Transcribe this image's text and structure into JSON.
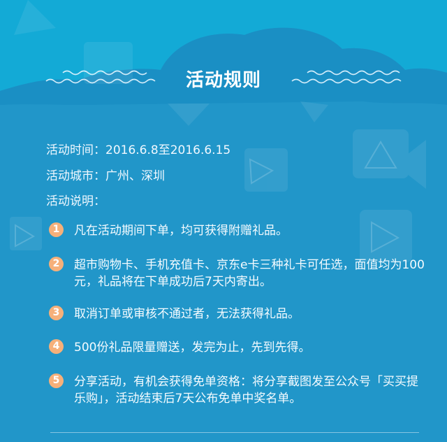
{
  "title": "活动规则",
  "info": {
    "time": "活动时间：2016.6.8至2016.6.15",
    "city": "活动城市：广州、深圳",
    "desc_label": "活动说明："
  },
  "rules": [
    {
      "num": "1",
      "text": "凡在活动期间下单，均可获得附赠礼品。"
    },
    {
      "num": "2",
      "text": "超市购物卡、手机充值卡、京东e卡三种礼卡可任选，面值均为100元，礼品将在下单成功后7天内寄出。"
    },
    {
      "num": "3",
      "text": "取消订单或审核不通过者，无法获得礼品。"
    },
    {
      "num": "4",
      "text": "500份礼品限量赠送，发完为止，先到先得。"
    },
    {
      "num": "5",
      "text": "分享活动，有机会获得免单资格：将分享截图发至公众号「买买提乐购」，活动结束后7天公布免单中奖名单。"
    }
  ],
  "colors": {
    "background": "#2196c9",
    "cloud": "#1b8cc0",
    "top_band": "#13aad6",
    "badge": "#f6b07a"
  }
}
